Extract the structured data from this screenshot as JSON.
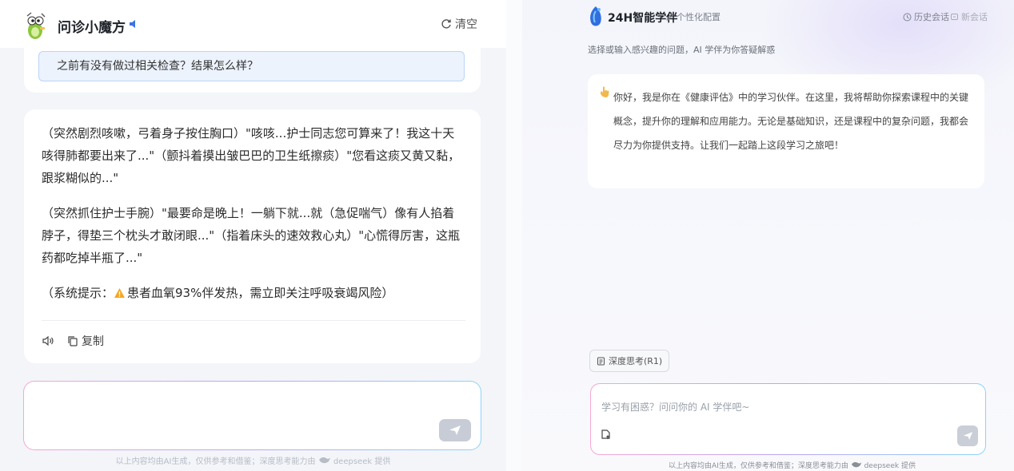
{
  "left": {
    "title": "问诊小魔方",
    "clear_label": "清空",
    "question": "之前有没有做过相关检查？结果怎么样？",
    "answer_paragraphs": [
      "（突然剧烈咳嗽，弓着身子按住胸口）\"咳咳...护士同志您可算来了！我这十天咳得肺都要出来了...\"（颤抖着摸出皱巴巴的卫生纸擦痰）\"您看这痰又黄又黏，跟浆糊似的...\"",
      "（突然抓住护士手腕）\"最要命是晚上！一躺下就...就（急促喘气）像有人掐着脖子，得垫三个枕头才敢闭眼...\"（指着床头的速效救心丸）\"心慌得厉害，这瓶药都吃掉半瓶了...\""
    ],
    "system_prefix": "（系统提示：",
    "system_body": "患者血氧93%伴发热，需立即关注呼吸衰竭风险）",
    "action_copy": "复制",
    "footer_prefix": "以上内容均由AI生成，仅供参考和借鉴；深度思考能力由",
    "footer_brand": "deepseek",
    "footer_suffix": "提供"
  },
  "right": {
    "title": "24H智能学伴",
    "config_label": "个性化配置",
    "history_label": "历史会话",
    "new_label": "新会话",
    "subtitle": "选择或输入感兴趣的问题，AI 学伴为你答疑解惑",
    "welcome": "你好，我是你在《健康评估》中的学习伙伴。在这里，我将帮助你探索课程中的关键概念，提升你的理解和应用能力。无论是基础知识，还是课程中的复杂问题，我都会尽力为你提供支持。让我们一起踏上这段学习之旅吧！",
    "deep_think_label": "深度思考(R1)",
    "input_placeholder": "学习有困惑？问问你的 AI 学伴吧~",
    "footer_prefix": "以上内容均由AI生成，仅供参考和借鉴；深度思考能力由",
    "footer_brand": "deepseek",
    "footer_suffix": "提供"
  },
  "colors": {
    "accent_blue": "#3b74e6",
    "question_bg": "#ecf3fd",
    "send_disabled": "#c7ccd6",
    "warning": "#f5a623"
  },
  "icons": [
    "mascot-icon",
    "speaker-icon",
    "refresh-icon",
    "warning-icon",
    "volume-icon",
    "copy-icon",
    "send-icon",
    "logo-icon",
    "edit-icon",
    "history-icon",
    "new-chat-icon",
    "hand-icon",
    "deep-think-icon",
    "upload-icon",
    "deepseek-whale-icon"
  ]
}
